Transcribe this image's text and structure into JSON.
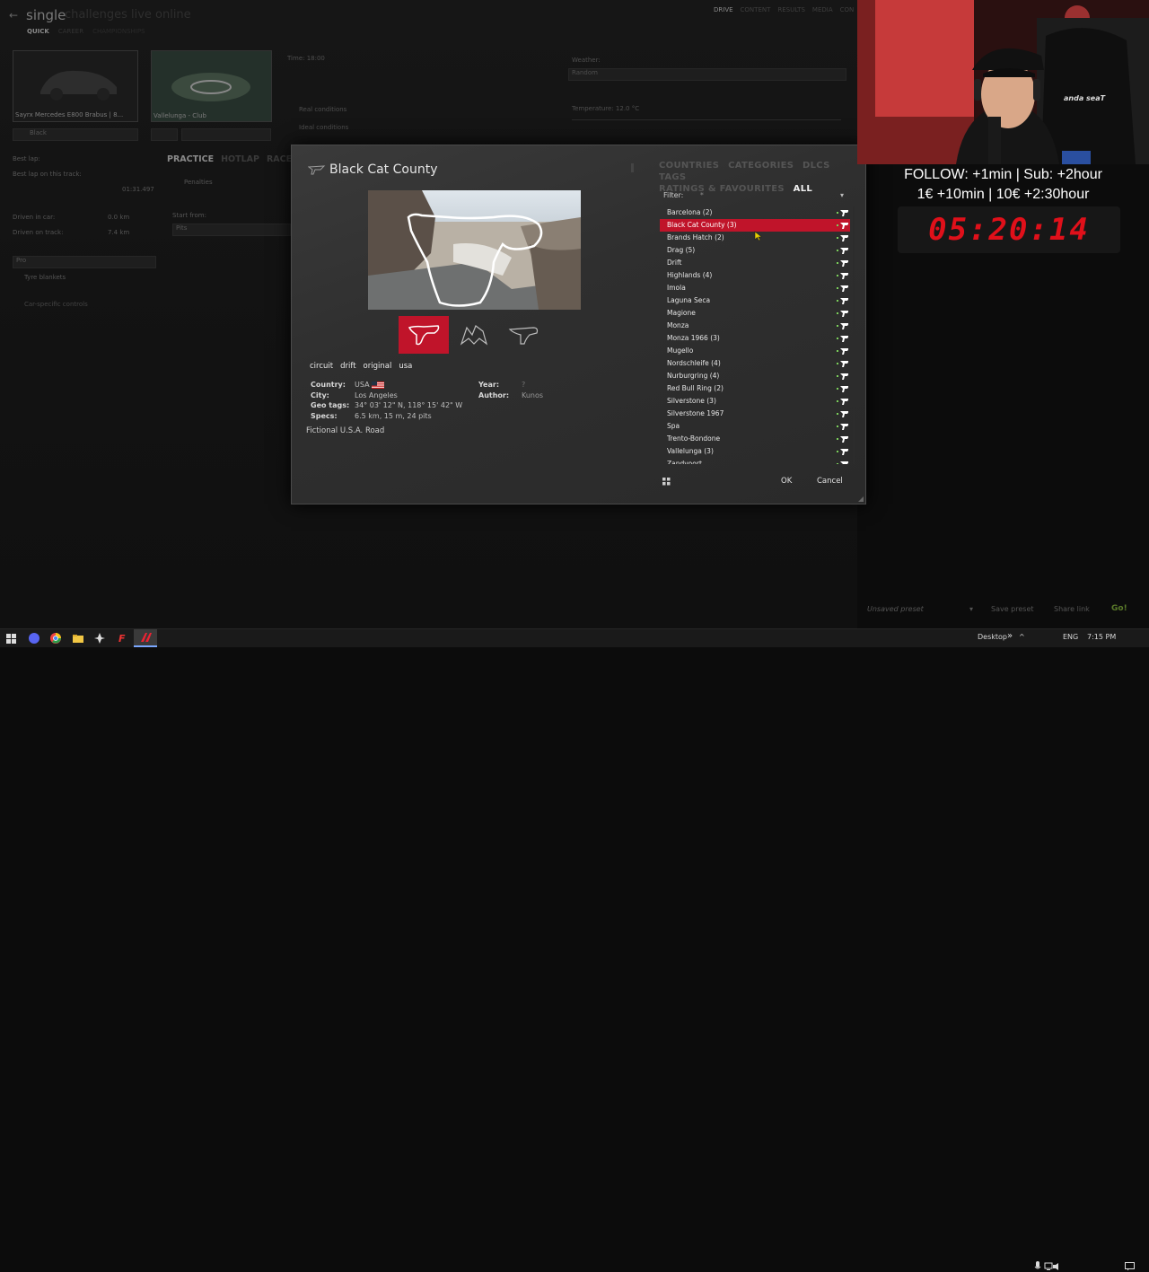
{
  "background_app": {
    "brand": "single",
    "brand_faded": "challenges  live  online",
    "top_nav": [
      "DRIVE",
      "CONTENT",
      "RESULTS",
      "MEDIA",
      "CON"
    ],
    "subnav": [
      "QUICK",
      "CAREER",
      "CHAMPIONSHIPS"
    ],
    "car_name": "Sayrx Mercedes E800 Brabus | 8...",
    "track_name": "Vallelunga - Club",
    "skin": "Black",
    "time_label": "Time: 18:00",
    "weather_label": "Weather:",
    "weather_value": "Random",
    "temperature_label": "Temperature: 12.0 °C",
    "real_conditions": "Real conditions",
    "ideal_conditions": "Ideal conditions",
    "best_lap_label": "Best lap:",
    "best_lap_track_label": "Best lap on this track:",
    "best_lap_track_value": "01:31.497",
    "driven_in_car_label": "Driven in car:",
    "driven_in_car_value": "0.0 km",
    "driven_on_track_label": "Driven on track:",
    "driven_on_track_value": "7.4 km",
    "mode_tabs": [
      "PRACTICE",
      "HOTLAP",
      "RACE"
    ],
    "penalties": "Penalties",
    "start_from_label": "Start from:",
    "start_from_value": "Pits",
    "assist_preset": "Pro",
    "tyre_blankets": "Tyre blankets",
    "car_controls": "Car-specific controls",
    "bottom_preset": "Unsaved preset",
    "save_preset": "Save preset",
    "share_link": "Share link",
    "go": "Go!"
  },
  "dialog": {
    "title": "Black Cat County",
    "tags": [
      "circuit",
      "drift",
      "original",
      "usa"
    ],
    "country_label": "Country:",
    "country_value": "USA",
    "city_label": "City:",
    "city_value": "Los Angeles",
    "geo_label": "Geo tags:",
    "geo_value": "34° 03' 12\" N, 118° 15' 42\" W",
    "specs_label": "Specs:",
    "specs_value": "6.5 km, 15 m, 24 pits",
    "year_label": "Year:",
    "year_value": "?",
    "author_label": "Author:",
    "author_value": "Kunos",
    "description": "Fictional U.S.A. Road",
    "categories": [
      "COUNTRIES",
      "CATEGORIES",
      "DLCS",
      "TAGS",
      "RATINGS & FAVOURITES",
      "ALL"
    ],
    "filter_label": "Filter:",
    "filter_value": "*",
    "tracks": [
      "Barcelona (2)",
      "Black Cat County (3)",
      "Brands Hatch (2)",
      "Drag (5)",
      "Drift",
      "Highlands (4)",
      "Imola",
      "Laguna Seca",
      "Magione",
      "Monza",
      "Monza 1966 (3)",
      "Mugello",
      "Nordschleife (4)",
      "Nurburgring (4)",
      "Red Bull Ring (2)",
      "Silverstone (3)",
      "Silverstone 1967",
      "Spa",
      "Trento-Bondone",
      "Vallelunga (3)",
      "Zandvoort"
    ],
    "selected_track_index": 1,
    "ok": "OK",
    "cancel": "Cancel"
  },
  "overlay": {
    "follow_line1": "FOLLOW: +1min | Sub: +2hour",
    "follow_line2": "1€ +10min | 10€ +2:30hour",
    "timer": "05:20:14",
    "chair_brand": "anda seaT"
  },
  "taskbar": {
    "desktop": "Desktop",
    "chevron": "»",
    "lang": "ENG",
    "time": "7:15 PM"
  },
  "colors": {
    "accent_red": "#c0142a",
    "timer_red": "#e0101a",
    "go_green": "#5a7a2a"
  }
}
